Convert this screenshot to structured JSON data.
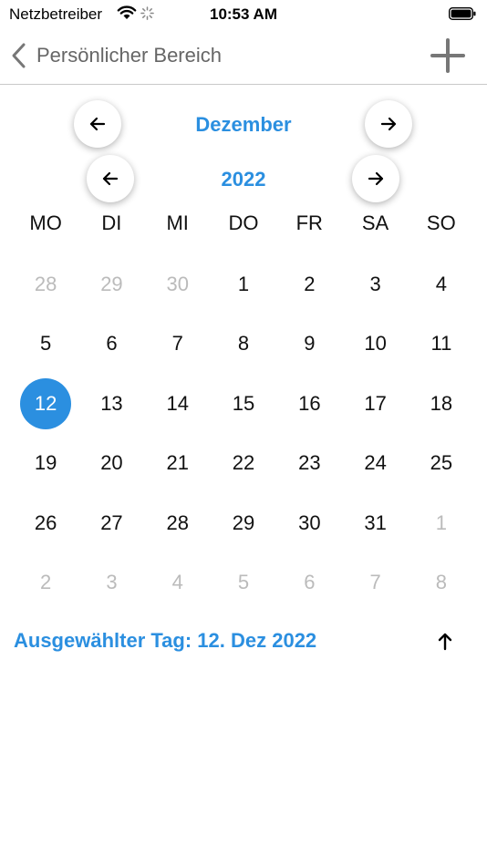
{
  "status_bar": {
    "carrier": "Netzbetreiber",
    "time": "10:53 AM"
  },
  "nav": {
    "back_label": "Persönlicher Bereich"
  },
  "calendar": {
    "month": "Dezember",
    "year": "2022",
    "weekdays": [
      "MO",
      "DI",
      "MI",
      "DO",
      "FR",
      "SA",
      "SO"
    ],
    "days": [
      {
        "label": "28",
        "muted": true
      },
      {
        "label": "29",
        "muted": true
      },
      {
        "label": "30",
        "muted": true
      },
      {
        "label": "1"
      },
      {
        "label": "2"
      },
      {
        "label": "3"
      },
      {
        "label": "4"
      },
      {
        "label": "5"
      },
      {
        "label": "6"
      },
      {
        "label": "7"
      },
      {
        "label": "8"
      },
      {
        "label": "9"
      },
      {
        "label": "10"
      },
      {
        "label": "11"
      },
      {
        "label": "12",
        "selected": true
      },
      {
        "label": "13"
      },
      {
        "label": "14"
      },
      {
        "label": "15"
      },
      {
        "label": "16"
      },
      {
        "label": "17"
      },
      {
        "label": "18"
      },
      {
        "label": "19"
      },
      {
        "label": "20"
      },
      {
        "label": "21"
      },
      {
        "label": "22"
      },
      {
        "label": "23"
      },
      {
        "label": "24"
      },
      {
        "label": "25"
      },
      {
        "label": "26"
      },
      {
        "label": "27"
      },
      {
        "label": "28"
      },
      {
        "label": "29"
      },
      {
        "label": "30"
      },
      {
        "label": "31"
      },
      {
        "label": "1",
        "muted": true
      },
      {
        "label": "2",
        "muted": true
      },
      {
        "label": "3",
        "muted": true
      },
      {
        "label": "4",
        "muted": true
      },
      {
        "label": "5",
        "muted": true
      },
      {
        "label": "6",
        "muted": true
      },
      {
        "label": "7",
        "muted": true
      },
      {
        "label": "8",
        "muted": true
      }
    ],
    "selected_text": "Ausgewählter Tag: 12. Dez 2022"
  },
  "colors": {
    "accent": "#2b8fe0",
    "muted": "#bbbbbb"
  },
  "icons": {
    "back": "chevron-left-icon",
    "add": "plus-icon",
    "prev": "arrow-left-icon",
    "next": "arrow-right-icon",
    "up": "arrow-up-icon"
  }
}
